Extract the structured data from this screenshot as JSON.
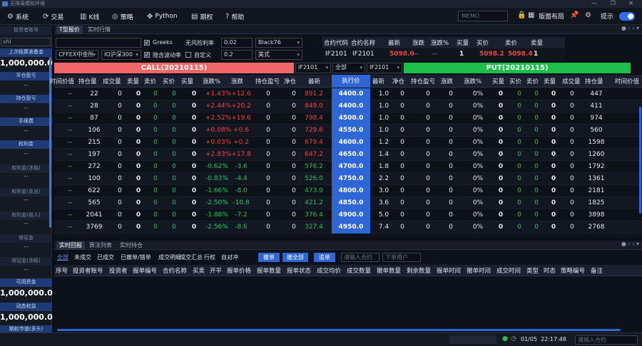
{
  "window": {
    "title": "无限易模拟环境",
    "controls": "— ❐ ✕"
  },
  "menu": [
    {
      "icon": "⚙",
      "label": "系统"
    },
    {
      "icon": "⟳",
      "label": "交易"
    },
    {
      "icon": "▥",
      "label": "K线"
    },
    {
      "icon": "◎",
      "label": "策略"
    },
    {
      "icon": "✥",
      "label": "Python"
    },
    {
      "icon": "▤",
      "label": "期权"
    },
    {
      "icon": "?",
      "label": "帮助"
    }
  ],
  "toolbar": {
    "memo_placeholder": "MEMO",
    "layout_label": "版面布局",
    "hint_label": "提示"
  },
  "left_panel": {
    "investor_label": "投资者账号",
    "investor_value": "shi",
    "items": [
      {
        "label": "上次结算准备金",
        "value": "1,000,000.0",
        "style": "big",
        "blue": true
      },
      {
        "label": "平仓盈亏",
        "value": "--",
        "style": "dash",
        "blue": true
      },
      {
        "label": "持仓盈亏",
        "value": "--",
        "style": "dash",
        "blue": true
      },
      {
        "label": "手续费",
        "value": "--",
        "style": "dash",
        "blue": true
      },
      {
        "label": "权利金",
        "value": "--",
        "style": "dash",
        "blue": true
      },
      {
        "label": "权利金(冻结)",
        "value": "--",
        "style": "dash",
        "blue": false
      },
      {
        "label": "权利金(支出)",
        "value": "--",
        "style": "dash",
        "blue": false
      },
      {
        "label": "权利金(收入)",
        "value": "--",
        "style": "dash",
        "blue": false
      },
      {
        "label": "保证金",
        "value": "--",
        "style": "dash",
        "blue": false
      },
      {
        "label": "保证金(冻结)",
        "value": "--",
        "style": "dash",
        "blue": false
      },
      {
        "label": "可用资金",
        "value": "1,000,000.0",
        "style": "big",
        "blue": true
      },
      {
        "label": "动态权益",
        "value": "1,000,000.0",
        "style": "big",
        "blue": true
      },
      {
        "label": "期权市值(多头)",
        "value": "",
        "style": "dash",
        "blue": true
      }
    ]
  },
  "tabs": {
    "t_quote": "T型报价",
    "realtime": "实时行情"
  },
  "controls": {
    "product_select": "",
    "greeks_label": "Greeks",
    "riskfree_label": "无风险利率",
    "riskfree_value": "0.02",
    "model_value": "Black76",
    "exchange_value": "CFFEX中金所",
    "underlying_value": "IO沪深300",
    "implied_vol_label": "隐含波动率",
    "custom_label": "自定义",
    "custom_value": "0.2",
    "style_value": "美式"
  },
  "quote": {
    "headers": [
      "合约代码",
      "合约名称",
      "最新",
      "涨跌",
      "涨跌%",
      "买量",
      "买价",
      "卖价",
      "卖量"
    ],
    "values": [
      "IF2101",
      "IF2101",
      "5098.0",
      "--",
      "--",
      "1",
      "5098.2",
      "5098.4",
      "1"
    ]
  },
  "call_label": "CALL(20210115)",
  "put_label": "PUT(20210115)",
  "filters": {
    "left_contract": "IF2101",
    "all": "全部",
    "right_contract": "IF2101"
  },
  "table_headers": {
    "call": [
      "时间价值",
      "持仓量",
      "成交量",
      "卖量",
      "卖价",
      "买价",
      "买量",
      "涨跌%",
      "涨跌",
      "持仓盈亏",
      "净仓",
      "最新"
    ],
    "strike": "执行价",
    "put": [
      "最新",
      "净仓",
      "持仓盈亏",
      "涨跌",
      "涨跌%",
      "买量",
      "买价",
      "卖价",
      "卖量",
      "成交量",
      "持仓量",
      "时间价值"
    ]
  },
  "rows": [
    {
      "tv": "--",
      "oi": "22",
      "vol": "0",
      "sq": "0",
      "sp": "0",
      "bp": "0",
      "bq": "0",
      "pct": "+1.43%",
      "chg": "+12.6",
      "pnl": "0",
      "net": "0",
      "last": "891.2",
      "strike": "4400.0",
      "p_last": "1.0",
      "p_net": "0",
      "p_pnl": "0",
      "p_chg": "0",
      "p_pct": "0%",
      "p_bq": "0",
      "p_bp": "0",
      "p_sp": "0",
      "p_sq": "0",
      "p_vol": "0",
      "p_oi": "447",
      "p_tv": ""
    },
    {
      "tv": "--",
      "oi": "28",
      "vol": "0",
      "sq": "0",
      "sp": "0",
      "bp": "0",
      "bq": "0",
      "pct": "+2.44%",
      "chg": "+20.2",
      "pnl": "0",
      "net": "0",
      "last": "849.0",
      "strike": "4400.0",
      "p_last": "1.0",
      "p_net": "0",
      "p_pnl": "0",
      "p_chg": "0",
      "p_pct": "0%",
      "p_bq": "0",
      "p_bp": "0",
      "p_sp": "0",
      "p_sq": "0",
      "p_vol": "0",
      "p_oi": "411",
      "p_tv": ""
    },
    {
      "tv": "--",
      "oi": "87",
      "vol": "0",
      "sq": "0",
      "sp": "0",
      "bp": "0",
      "bq": "0",
      "pct": "+2.52%",
      "chg": "+19.6",
      "pnl": "0",
      "net": "0",
      "last": "798.4",
      "strike": "4500.0",
      "p_last": "1.0",
      "p_net": "0",
      "p_pnl": "0",
      "p_chg": "0",
      "p_pct": "0%",
      "p_bq": "0",
      "p_bp": "0",
      "p_sp": "0",
      "p_sq": "0",
      "p_vol": "0",
      "p_oi": "974",
      "p_tv": ""
    },
    {
      "tv": "--",
      "oi": "106",
      "vol": "0",
      "sq": "0",
      "sp": "0",
      "bp": "0",
      "bq": "0",
      "pct": "+0.08%",
      "chg": "+0.6",
      "pnl": "0",
      "net": "0",
      "last": "729.6",
      "strike": "4550.0",
      "p_last": "1.0",
      "p_net": "0",
      "p_pnl": "0",
      "p_chg": "0",
      "p_pct": "0%",
      "p_bq": "0",
      "p_bp": "0",
      "p_sp": "0",
      "p_sq": "0",
      "p_vol": "0",
      "p_oi": "560",
      "p_tv": ""
    },
    {
      "tv": "--",
      "oi": "215",
      "vol": "0",
      "sq": "0",
      "sp": "0",
      "bp": "0",
      "bq": "0",
      "pct": "+0.03%",
      "chg": "+0.2",
      "pnl": "0",
      "net": "0",
      "last": "679.4",
      "strike": "4600.0",
      "p_last": "1.2",
      "p_net": "0",
      "p_pnl": "0",
      "p_chg": "0",
      "p_pct": "0%",
      "p_bq": "0",
      "p_bp": "0",
      "p_sp": "0",
      "p_sq": "0",
      "p_vol": "0",
      "p_oi": "1598",
      "p_tv": ""
    },
    {
      "tv": "--",
      "oi": "197",
      "vol": "0",
      "sq": "0",
      "sp": "0",
      "bp": "0",
      "bq": "0",
      "pct": "+2.83%",
      "chg": "+17.8",
      "pnl": "0",
      "net": "0",
      "last": "647.2",
      "strike": "4650.0",
      "p_last": "1.4",
      "p_net": "0",
      "p_pnl": "0",
      "p_chg": "0",
      "p_pct": "0%",
      "p_bq": "0",
      "p_bp": "0",
      "p_sp": "0",
      "p_sq": "0",
      "p_vol": "0",
      "p_oi": "1260",
      "p_tv": ""
    },
    {
      "tv": "--",
      "oi": "272",
      "vol": "0",
      "sq": "0",
      "sp": "0",
      "bp": "0",
      "bq": "0",
      "pct": "-0.62%",
      "chg": "-3.6",
      "pnl": "0",
      "net": "0",
      "last": "576.2",
      "strike": "4700.0",
      "p_last": "1.8",
      "p_net": "0",
      "p_pnl": "0",
      "p_chg": "0",
      "p_pct": "0%",
      "p_bq": "0",
      "p_bp": "0",
      "p_sp": "0",
      "p_sq": "0",
      "p_vol": "0",
      "p_oi": "1792",
      "p_tv": ""
    },
    {
      "tv": "--",
      "oi": "100",
      "vol": "0",
      "sq": "0",
      "sp": "0",
      "bp": "0",
      "bq": "0",
      "pct": "-0.83%",
      "chg": "-4.4",
      "pnl": "0",
      "net": "0",
      "last": "526.0",
      "strike": "4750.0",
      "p_last": "2.2",
      "p_net": "0",
      "p_pnl": "0",
      "p_chg": "0",
      "p_pct": "0%",
      "p_bq": "0",
      "p_bp": "0",
      "p_sp": "0",
      "p_sq": "0",
      "p_vol": "0",
      "p_oi": "1361",
      "p_tv": ""
    },
    {
      "tv": "--",
      "oi": "622",
      "vol": "0",
      "sq": "0",
      "sp": "0",
      "bp": "0",
      "bq": "0",
      "pct": "-1.66%",
      "chg": "-8.0",
      "pnl": "0",
      "net": "0",
      "last": "473.0",
      "strike": "4800.0",
      "p_last": "3.0",
      "p_net": "0",
      "p_pnl": "0",
      "p_chg": "0",
      "p_pct": "0%",
      "p_bq": "0",
      "p_bp": "0",
      "p_sp": "0",
      "p_sq": "0",
      "p_vol": "0",
      "p_oi": "2181",
      "p_tv": ""
    },
    {
      "tv": "--",
      "oi": "565",
      "vol": "0",
      "sq": "0",
      "sp": "0",
      "bp": "0",
      "bq": "0",
      "pct": "-2.50%",
      "chg": "-10.8",
      "pnl": "0",
      "net": "0",
      "last": "421.2",
      "strike": "4850.0",
      "p_last": "3.6",
      "p_net": "0",
      "p_pnl": "0",
      "p_chg": "0",
      "p_pct": "0%",
      "p_bq": "0",
      "p_bp": "0",
      "p_sp": "0",
      "p_sq": "0",
      "p_vol": "0",
      "p_oi": "1825",
      "p_tv": ""
    },
    {
      "tv": "--",
      "oi": "2041",
      "vol": "0",
      "sq": "0",
      "sp": "0",
      "bp": "0",
      "bq": "0",
      "pct": "-1.88%",
      "chg": "-7.2",
      "pnl": "0",
      "net": "0",
      "last": "376.4",
      "strike": "4900.0",
      "p_last": "5.0",
      "p_net": "0",
      "p_pnl": "0",
      "p_chg": "0",
      "p_pct": "0%",
      "p_bq": "0",
      "p_bp": "0",
      "p_sp": "0",
      "p_sq": "0",
      "p_vol": "0",
      "p_oi": "3898",
      "p_tv": ""
    },
    {
      "tv": "--",
      "oi": "3769",
      "vol": "0",
      "sq": "0",
      "sp": "0",
      "bp": "0",
      "bq": "0",
      "pct": "-2.56%",
      "chg": "-8.6",
      "pnl": "0",
      "net": "0",
      "last": "327.4",
      "strike": "4950.0",
      "p_last": "7.4",
      "p_net": "0",
      "p_pnl": "0",
      "p_chg": "0",
      "p_pct": "0%",
      "p_bq": "0",
      "p_bp": "0",
      "p_sp": "0",
      "p_sq": "0",
      "p_vol": "0",
      "p_oi": "2768",
      "p_tv": ""
    }
  ],
  "bottom": {
    "tabs": [
      "实时回报",
      "算法列表",
      "实时持仓"
    ],
    "filters": [
      "全部",
      "未成交",
      "已成交",
      "已撤单/错单",
      "成交明细",
      "成交汇总",
      "行权",
      "自对冲"
    ],
    "btn_cancel": "撤单",
    "btn_cancel_all": "撤全部",
    "btn_chase": "追单",
    "contract_placeholder": "请输入合约",
    "user_placeholder": "下单用户",
    "headers": [
      "序号",
      "投资者账号",
      "投资者",
      "报单编号",
      "合约名称",
      "买卖",
      "开平",
      "报单价格",
      "报单数量",
      "报单状态",
      "成交均价",
      "成交数量",
      "撤单数量",
      "剩余数量",
      "报单时间",
      "撤单时间",
      "成交时间",
      "类型",
      "时态",
      "策略编号",
      "备注"
    ]
  },
  "status": {
    "date": "01/05",
    "time": "22:17:48",
    "contract_placeholder": "请输入合约"
  }
}
